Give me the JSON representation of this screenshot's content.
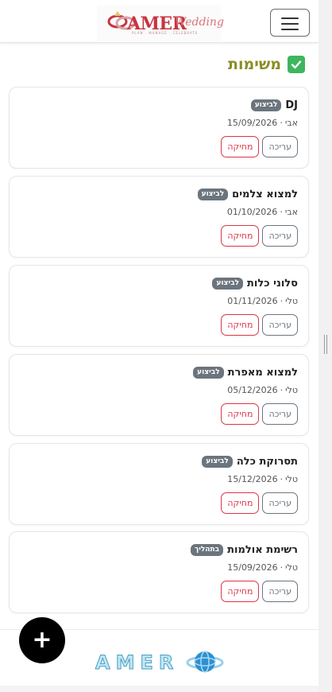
{
  "brand": {
    "logo_main": "AMER",
    "logo_script": "Wedding",
    "logo_tagline": "PLAN · MANAGE · CELEBRATE",
    "footer_logo": "AMER"
  },
  "header": {
    "menu_icon": "hamburger-icon"
  },
  "page": {
    "title": "משימות",
    "title_icon": "check-box-icon"
  },
  "labels": {
    "edit": "עריכה",
    "delete": "מחיקה"
  },
  "tasks": [
    {
      "title": "DJ",
      "status": "לביצוע",
      "owner": "אבי",
      "date": "15/09/2026"
    },
    {
      "title": "למצוא צלמים",
      "status": "לביצוע",
      "owner": "אבי",
      "date": "01/10/2026"
    },
    {
      "title": "סלוני כלות",
      "status": "לביצוע",
      "owner": "טלי",
      "date": "01/11/2026"
    },
    {
      "title": "למצוא מאפרת",
      "status": "לביצוע",
      "owner": "טלי",
      "date": "05/12/2026"
    },
    {
      "title": "תסרוקת כלה",
      "status": "לביצוע",
      "owner": "טלי",
      "date": "15/12/2026"
    },
    {
      "title": "רשימת אולמות",
      "status": "בתהליך",
      "owner": "טלי",
      "date": "15/09/2026"
    }
  ],
  "fab": {
    "label": "+"
  },
  "colors": {
    "title": "#8a8d24",
    "badge": "#6c757d",
    "delete": "#dc3545",
    "check": "#3eb55f"
  }
}
